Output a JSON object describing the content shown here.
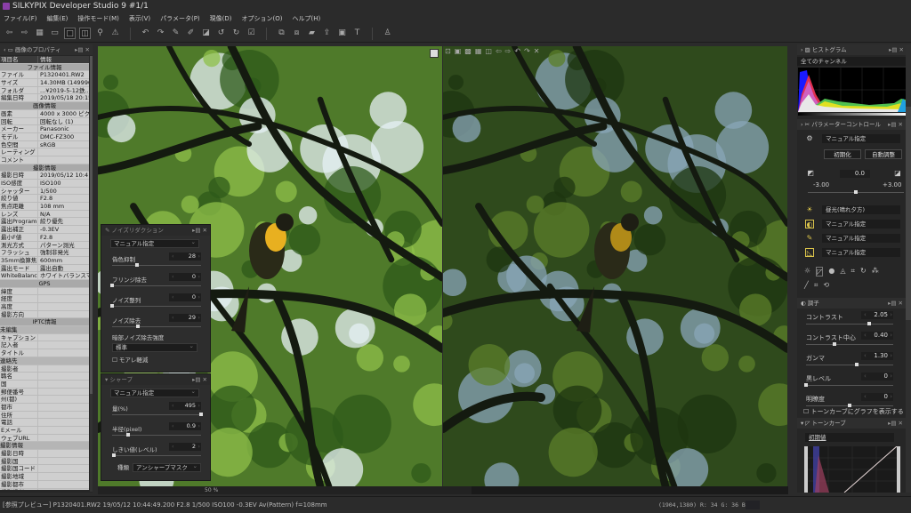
{
  "app": {
    "title": "SILKYPIX Developer Studio 9   #1/1"
  },
  "menu": [
    "ファイル(F)",
    "編集(E)",
    "操作モード(M)",
    "表示(V)",
    "パラメータ(P)",
    "現像(D)",
    "オプション(O)",
    "ヘルプ(H)"
  ],
  "toolbar": [
    {
      "icon": "prev-icon",
      "g": "⇦"
    },
    {
      "icon": "next-icon",
      "g": "⇨"
    },
    {
      "icon": "thumbnail-view-icon",
      "g": "▦"
    },
    {
      "icon": "preview-strip-icon",
      "g": "▭"
    },
    {
      "icon": "single-view-icon",
      "g": "□",
      "sel": true
    },
    {
      "icon": "compare-view-icon",
      "g": "◫",
      "sel": true
    },
    {
      "icon": "zoom-icon",
      "g": "⚲"
    },
    {
      "icon": "warning-icon",
      "g": "⚠"
    },
    {
      "sep": true
    },
    {
      "icon": "undo-icon",
      "g": "↶"
    },
    {
      "icon": "redo-icon",
      "g": "↷"
    },
    {
      "icon": "paste-icon",
      "g": "✎"
    },
    {
      "icon": "copy-icon",
      "g": "✐"
    },
    {
      "icon": "clear-icon",
      "g": "◪"
    },
    {
      "icon": "rotate-left-icon",
      "g": "↺"
    },
    {
      "icon": "rotate-right-icon",
      "g": "↻"
    },
    {
      "icon": "mark-icon",
      "g": "☑"
    },
    {
      "sep": true
    },
    {
      "icon": "develop-icon",
      "g": "⧉"
    },
    {
      "icon": "batch-icon",
      "g": "⧈"
    },
    {
      "icon": "sd-card-icon",
      "g": "▰"
    },
    {
      "icon": "export-icon",
      "g": "⇪"
    },
    {
      "icon": "display-icon",
      "g": "▣"
    },
    {
      "icon": "hammer-icon",
      "g": "T"
    },
    {
      "sep": true
    },
    {
      "icon": "account-icon",
      "g": "♙"
    }
  ],
  "left_panel": {
    "title": "画像のプロパティ",
    "header": [
      "項目名",
      "情報"
    ],
    "rows": [
      {
        "t": "sec",
        "k": "ファイル情報"
      },
      {
        "k": "ファイル",
        "v": "P1320401.RW2"
      },
      {
        "k": "サイズ",
        "v": "14.30MB (1499904"
      },
      {
        "k": "フォルダ",
        "v": "...¥2019-5-12鉄..."
      },
      {
        "k": "編集日時",
        "v": "2019/05/18 20:15:"
      },
      {
        "t": "sec",
        "k": "画像情報"
      },
      {
        "k": "画素",
        "v": "4000 x 3000 ピクセル"
      },
      {
        "k": "回転",
        "v": "回転なし (1)"
      },
      {
        "k": "メーカー",
        "v": "Panasonic"
      },
      {
        "k": "モデル",
        "v": "DMC-FZ300"
      },
      {
        "k": "色空間",
        "v": "sRGB"
      },
      {
        "k": "レーティング",
        "v": ""
      },
      {
        "k": "コメント",
        "v": ""
      },
      {
        "t": "sec",
        "k": "撮影情報"
      },
      {
        "k": "撮影日時",
        "v": "2019/05/12 10:4"
      },
      {
        "k": "ISO感度",
        "v": "ISO100"
      },
      {
        "k": "シャッター",
        "v": "1/500"
      },
      {
        "k": "絞り値",
        "v": "F2.8"
      },
      {
        "k": "焦点距離",
        "v": "108 mm"
      },
      {
        "k": "レンズ",
        "v": "N/A"
      },
      {
        "k": "露出Program",
        "v": "絞り優先"
      },
      {
        "k": "露出補正",
        "v": "-0.3EV"
      },
      {
        "k": "最小F値",
        "v": "F2.8"
      },
      {
        "k": "測光方式",
        "v": "パターン測光"
      },
      {
        "k": "フラッシュ",
        "v": "強制非発光"
      },
      {
        "k": "35mm換算焦",
        "v": "600mm"
      },
      {
        "k": "露出モード",
        "v": "露出自動"
      },
      {
        "k": "WhiteBalance",
        "v": "ホワイトバランスマニュアル"
      },
      {
        "t": "sec",
        "k": "GPS"
      },
      {
        "k": "緯度",
        "v": ""
      },
      {
        "k": "経度",
        "v": ""
      },
      {
        "k": "高度",
        "v": ""
      },
      {
        "k": "撮影方向",
        "v": ""
      },
      {
        "t": "sec",
        "k": "IPTC情報"
      },
      {
        "t": "sub",
        "k": "未編集"
      },
      {
        "k": "キャプション",
        "v": ""
      },
      {
        "k": "記入者",
        "v": ""
      },
      {
        "k": "タイトル",
        "v": ""
      },
      {
        "t": "sub",
        "k": "連絡先"
      },
      {
        "k": "撮影者",
        "v": ""
      },
      {
        "k": "職名",
        "v": ""
      },
      {
        "k": "国",
        "v": ""
      },
      {
        "k": "郵便番号",
        "v": ""
      },
      {
        "k": "州(都)",
        "v": ""
      },
      {
        "k": "都市",
        "v": ""
      },
      {
        "k": "住所",
        "v": ""
      },
      {
        "k": "電話",
        "v": ""
      },
      {
        "k": "Eメール",
        "v": ""
      },
      {
        "k": "ウェブURL",
        "v": ""
      },
      {
        "t": "sub",
        "k": "撮影情報"
      },
      {
        "k": "撮影日時",
        "v": ""
      },
      {
        "k": "撮影国",
        "v": ""
      },
      {
        "k": "撮影国コード",
        "v": ""
      },
      {
        "k": "撮影地域",
        "v": ""
      },
      {
        "k": "撮影都市",
        "v": ""
      },
      {
        "k": "撮影場所",
        "v": ""
      }
    ]
  },
  "noise_panel": {
    "title": "ノイズリダクション",
    "preset": "マニュアル指定",
    "params": [
      {
        "label": "偽色抑制",
        "value": "28",
        "pos": 0.28
      },
      {
        "label": "フリンジ除去",
        "value": "0",
        "pos": 0
      },
      {
        "label": "ノイズ整列",
        "value": "0",
        "pos": 0
      },
      {
        "label": "ノイズ除去",
        "value": "29",
        "pos": 0.29
      }
    ],
    "dark_label": "暗部ノイズ除去強度",
    "dark_value": "標準",
    "moire_label": "モアレ軽減"
  },
  "sharp_panel": {
    "title": "シャープ",
    "preset": "マニュアル指定",
    "params": [
      {
        "label": "量(%)",
        "value": "495",
        "pos": 1
      },
      {
        "label": "半径(pixel)",
        "value": "0.9",
        "pos": 0.18
      },
      {
        "label": "しきい値(レベル)",
        "value": "2",
        "pos": 0.02
      }
    ],
    "type_label": "種類",
    "type_value": "アンシャープマスク"
  },
  "zoom": {
    "value": "50",
    "unit": "%"
  },
  "right_panel": {
    "histogram_title": "ヒストグラム",
    "channel": "全てのチャンネル",
    "param_title": "パラメーターコントロール",
    "taste": "マニュアル指定",
    "reset": "初期化",
    "auto": "自動調整",
    "exposure": "0.0",
    "exp_min": "-3.00",
    "exp_max": "+3.00",
    "wb": "昼光(晴れ夕方)",
    "tone_preset": "マニュアル指定",
    "color_preset": "マニュアル指定",
    "curve_preset": "マニュアル指定",
    "tone_title": "調子",
    "tone_params": [
      {
        "label": "コントラスト",
        "value": "2.05",
        "pos": 0.72
      },
      {
        "label": "コントラスト中心",
        "value": "0.40",
        "pos": 0.33
      },
      {
        "label": "ガンマ",
        "value": "1.30",
        "pos": 0.58
      },
      {
        "label": "黒レベル",
        "value": "0",
        "pos": 0
      },
      {
        "label": "明瞭度",
        "value": "0",
        "pos": 0.5
      }
    ],
    "show_graph": "トーンカーブにグラフを表示する",
    "curve_title": "トーンカーブ",
    "curve_value": "初期値"
  },
  "status": {
    "text": "[参照プレビュー] P1320401.RW2 19/05/12 10:44:49.200 F2.8 1/500 ISO100 -0.3EV Av(Pattern) f=108mm",
    "pixel": "(1904,1380) R: 34 G: 36 B: 30"
  }
}
